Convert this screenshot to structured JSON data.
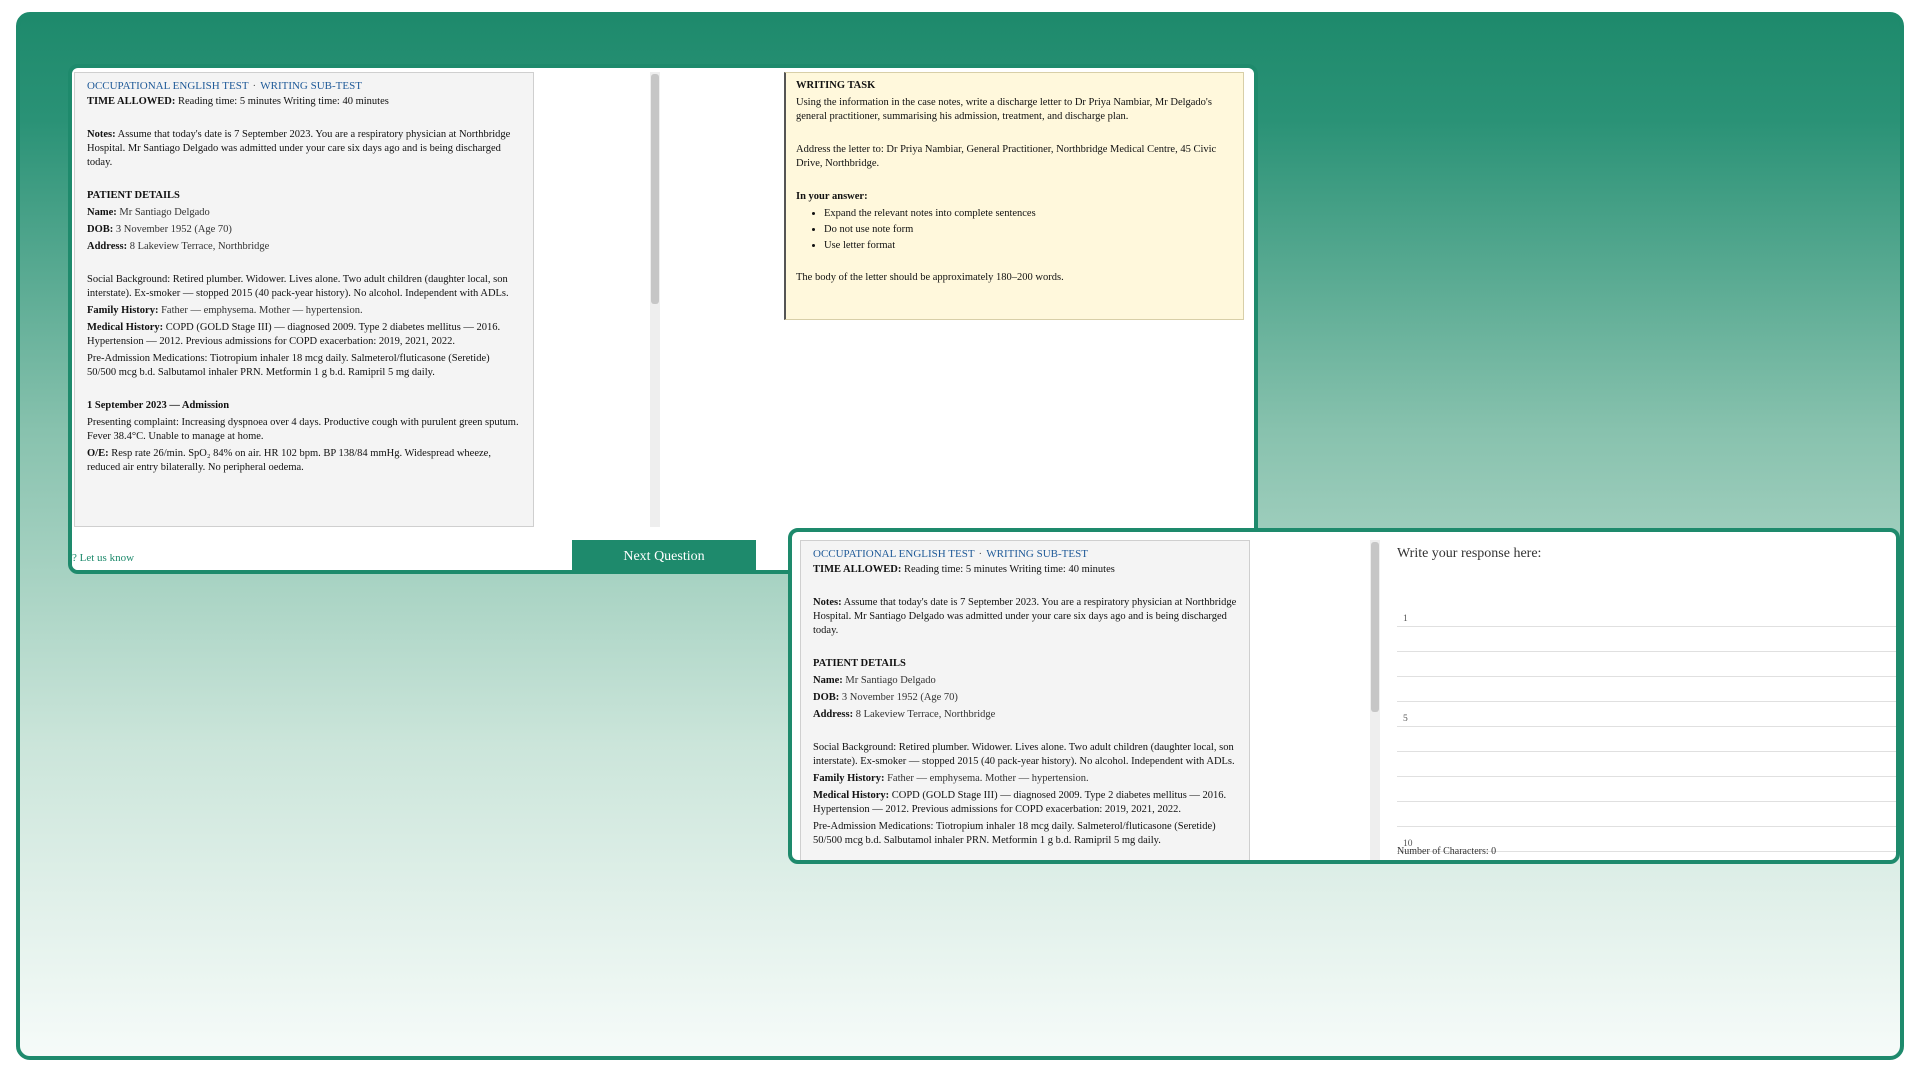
{
  "case_notes": {
    "header_test": "OCCUPATIONAL ENGLISH TEST",
    "header_sep": "·",
    "header_sub": "WRITING SUB-TEST",
    "time_label": "TIME ALLOWED:",
    "time_value": "Reading time: 5 minutes    Writing time: 40 minutes",
    "notes_label": "Notes:",
    "notes_text": "Assume that today's date is 7 September 2023. You are a respiratory physician at Northbridge Hospital. Mr Santiago Delgado was admitted under your care six days ago and is being discharged today.",
    "patient_heading": "PATIENT DETAILS",
    "name_label": "Name:",
    "name_value": "Mr Santiago Delgado",
    "dob_label": "DOB:",
    "dob_value": "3 November 1952  (Age 70)",
    "address_label": "Address:",
    "address_value": "8 Lakeview Terrace, Northbridge",
    "social_label": "Social Background:",
    "social_text": "Retired plumber. Widower. Lives alone. Two adult children (daughter local, son interstate). Ex-smoker — stopped 2015 (40 pack-year history). No alcohol. Independent with ADLs.",
    "family_label": "Family History:",
    "family_text": "Father — emphysema. Mother — hypertension.",
    "medical_label": "Medical History:",
    "medical_text": "COPD (GOLD Stage III) — diagnosed 2009. Type 2 diabetes mellitus — 2016. Hypertension — 2012. Previous admissions for COPD exacerbation: 2019, 2021, 2022.",
    "meds_label": "Pre-Admission Medications:",
    "meds_text": "Tiotropium inhaler 18 mcg daily. Salmeterol/fluticasone (Seretide) 50/500 mcg b.d. Salbutamol inhaler PRN. Metformin 1 g b.d. Ramipril 5 mg daily.",
    "admission_heading": "1 September 2023 — Admission",
    "presenting_label": "Presenting complaint:",
    "presenting_text": "Increasing dyspnoea over 4 days. Productive cough with purulent green sputum. Fever 38.4°C. Unable to manage at home.",
    "oe_label": "O/E:",
    "oe_text": "Resp rate 26/min. SpO₂ 84% on air. HR 102 bpm. BP 138/84 mmHg. Widespread wheeze, reduced air entry bilaterally. No peripheral oedema."
  },
  "writing_task": {
    "heading": "WRITING TASK",
    "intro": "Using the information in the case notes, write a discharge letter to Dr Priya Nambiar, Mr Delgado's general practitioner, summarising his admission, treatment, and discharge plan.",
    "address": "Address the letter to: Dr Priya Nambiar, General Practitioner, Northbridge Medical Centre, 45 Civic Drive, Northbridge.",
    "answer_heading": "In your answer:",
    "bullets": [
      "Expand the relevant notes into complete sentences",
      "Do not use note form",
      "Use letter format"
    ],
    "word_count": "The body of the letter should be approximately 180–200 words."
  },
  "footer": {
    "feedback_text": "? Let us know",
    "next_button": "Next Question"
  },
  "response": {
    "title": "Write your response here:",
    "line_numbers": [
      "1",
      "5",
      "10"
    ],
    "char_count": "Number of Characters: 0"
  },
  "colors": {
    "brand": "#1e8a6c",
    "task_bg": "#fff8dc",
    "header_link": "#1f5a98"
  }
}
